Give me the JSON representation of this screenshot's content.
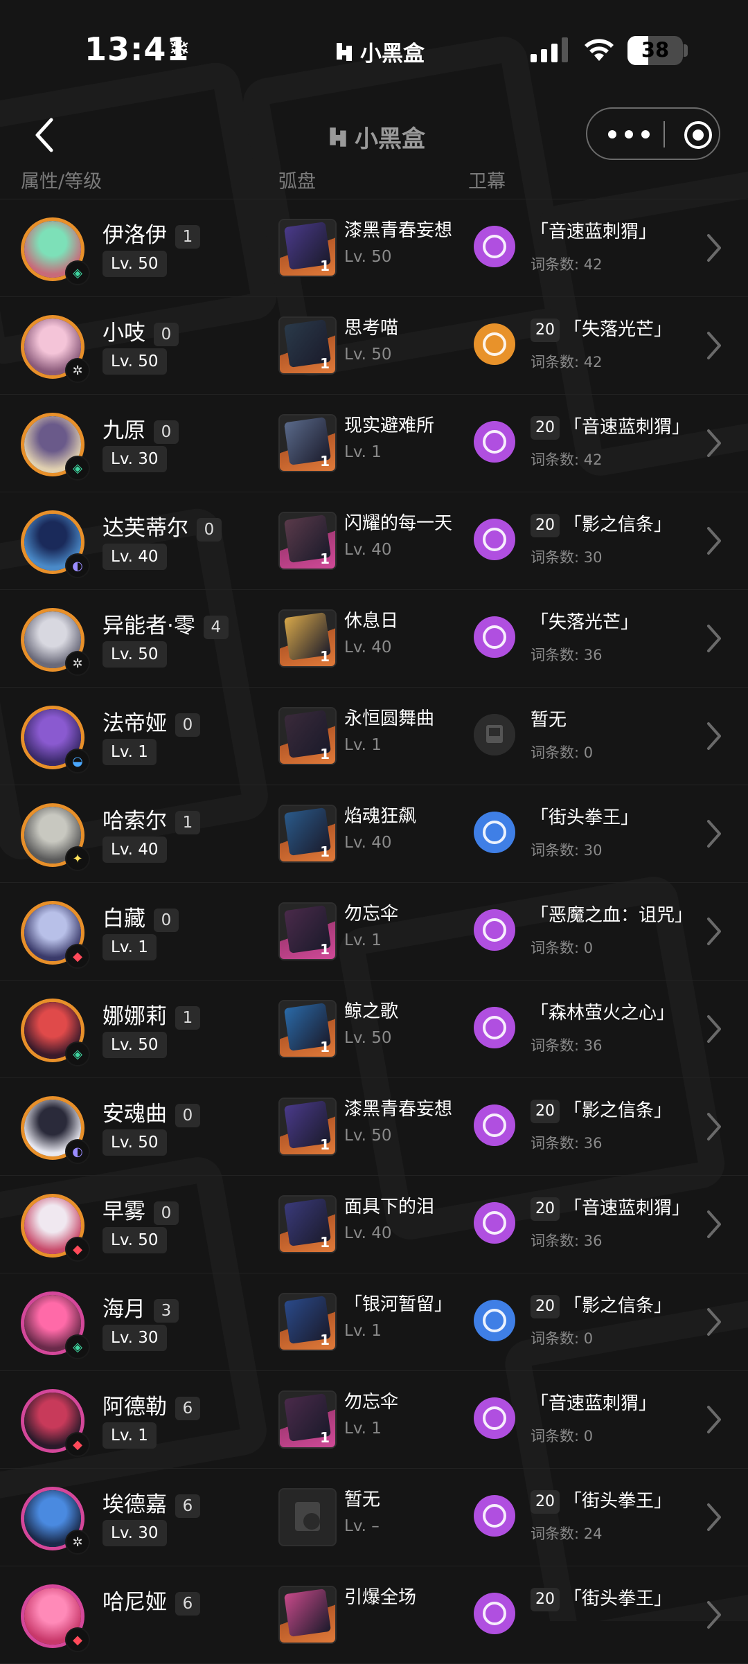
{
  "status_bar": {
    "time": "13:41",
    "snow": "❄",
    "brand": "小黑盒",
    "battery": "38",
    "battery_level": 0.38
  },
  "nav": {
    "title": "小黑盒"
  },
  "columns": {
    "char": "属性/等级",
    "disc": "弧盘",
    "cart": "卫幕"
  },
  "colors": {
    "orange_ring": "#e8902a",
    "pink_ring": "#d4479a",
    "purple": "#b04fe0",
    "blue": "#3f7fe6",
    "gold": "#e8922a"
  },
  "rows": [
    {
      "name": "伊洛伊",
      "mind": "1",
      "level": "Lv. 50",
      "element": "wind",
      "ring": "orange",
      "disc_name": "漆黑青春妄想",
      "disc_level": "Lv. 50",
      "disc_rank": "1",
      "disc_color": "orange",
      "cart_num": "",
      "cart_title": "「音速蓝刺猬」",
      "cart_count": "词条数: 42",
      "cart_color": "purple"
    },
    {
      "name": "小吱",
      "mind": "0",
      "level": "Lv. 50",
      "element": "physical",
      "ring": "orange",
      "disc_name": "思考喵",
      "disc_level": "Lv. 50",
      "disc_rank": "1",
      "disc_color": "orange",
      "cart_num": "20",
      "cart_title": "「失落光芒」",
      "cart_count": "词条数: 42",
      "cart_color": "gold"
    },
    {
      "name": "九原",
      "mind": "0",
      "level": "Lv. 30",
      "element": "wind",
      "ring": "orange",
      "disc_name": "现实避难所",
      "disc_level": "Lv. 1",
      "disc_rank": "1",
      "disc_color": "orange",
      "cart_num": "20",
      "cart_title": "「音速蓝刺猬」",
      "cart_count": "词条数: 42",
      "cart_color": "purple"
    },
    {
      "name": "达芙蒂尔",
      "mind": "0",
      "level": "Lv. 40",
      "element": "dark",
      "ring": "orange",
      "disc_name": "闪耀的每一天",
      "disc_level": "Lv. 40",
      "disc_rank": "1",
      "disc_color": "pink",
      "cart_num": "20",
      "cart_title": "「影之信条」",
      "cart_count": "词条数: 30",
      "cart_color": "purple"
    },
    {
      "name": "异能者·零",
      "mind": "4",
      "level": "Lv. 50",
      "element": "physical",
      "ring": "orange",
      "disc_name": "休息日",
      "disc_level": "Lv. 40",
      "disc_rank": "1",
      "disc_color": "orange",
      "cart_num": "",
      "cart_title": "「失落光芒」",
      "cart_count": "词条数: 36",
      "cart_color": "purple"
    },
    {
      "name": "法帝娅",
      "mind": "0",
      "level": "Lv. 1",
      "element": "water",
      "ring": "orange",
      "disc_name": "永恒圆舞曲",
      "disc_level": "Lv. 1",
      "disc_rank": "1",
      "disc_color": "orange",
      "cart_num": "",
      "cart_title": "暂无",
      "cart_count": "词条数: 0",
      "cart_color": "empty"
    },
    {
      "name": "哈索尔",
      "mind": "1",
      "level": "Lv. 40",
      "element": "light",
      "ring": "orange",
      "disc_name": "焰魂狂飙",
      "disc_level": "Lv. 40",
      "disc_rank": "1",
      "disc_color": "orange",
      "cart_num": "",
      "cart_title": "「街头拳王」",
      "cart_count": "词条数: 30",
      "cart_color": "blue"
    },
    {
      "name": "白藏",
      "mind": "0",
      "level": "Lv. 1",
      "element": "fire",
      "ring": "orange",
      "disc_name": "勿忘伞",
      "disc_level": "Lv. 1",
      "disc_rank": "1",
      "disc_color": "pink",
      "cart_num": "",
      "cart_title": "「恶魔之血：诅咒」",
      "cart_count": "词条数: 0",
      "cart_color": "purple"
    },
    {
      "name": "娜娜莉",
      "mind": "1",
      "level": "Lv. 50",
      "element": "wind",
      "ring": "orange",
      "disc_name": "鲸之歌",
      "disc_level": "Lv. 50",
      "disc_rank": "1",
      "disc_color": "orange",
      "cart_num": "",
      "cart_title": "「森林萤火之心」",
      "cart_count": "词条数: 36",
      "cart_color": "purple"
    },
    {
      "name": "安魂曲",
      "mind": "0",
      "level": "Lv. 50",
      "element": "dark",
      "ring": "orange",
      "disc_name": "漆黑青春妄想",
      "disc_level": "Lv. 50",
      "disc_rank": "1",
      "disc_color": "orange",
      "cart_num": "20",
      "cart_title": "「影之信条」",
      "cart_count": "词条数: 36",
      "cart_color": "purple"
    },
    {
      "name": "早雾",
      "mind": "0",
      "level": "Lv. 50",
      "element": "fire",
      "ring": "orange",
      "disc_name": "面具下的泪",
      "disc_level": "Lv. 40",
      "disc_rank": "1",
      "disc_color": "orange",
      "cart_num": "20",
      "cart_title": "「音速蓝刺猬」",
      "cart_count": "词条数: 36",
      "cart_color": "purple"
    },
    {
      "name": "海月",
      "mind": "3",
      "level": "Lv. 30",
      "element": "wind",
      "ring": "pink",
      "disc_name": "「银河暂留」",
      "disc_level": "Lv. 1",
      "disc_rank": "1",
      "disc_color": "orange",
      "cart_num": "20",
      "cart_title": "「影之信条」",
      "cart_count": "词条数: 0",
      "cart_color": "blue"
    },
    {
      "name": "阿德勒",
      "mind": "6",
      "level": "Lv. 1",
      "element": "fire",
      "ring": "pink",
      "disc_name": "勿忘伞",
      "disc_level": "Lv. 1",
      "disc_rank": "1",
      "disc_color": "pink",
      "cart_num": "",
      "cart_title": "「音速蓝刺猬」",
      "cart_count": "词条数: 0",
      "cart_color": "purple"
    },
    {
      "name": "埃德嘉",
      "mind": "6",
      "level": "Lv. 30",
      "element": "physical",
      "ring": "pink",
      "disc_name": "暂无",
      "disc_level": "Lv. –",
      "disc_rank": "",
      "disc_color": "empty",
      "cart_num": "20",
      "cart_title": "「街头拳王」",
      "cart_count": "词条数: 24",
      "cart_color": "purple"
    },
    {
      "name": "哈尼娅",
      "mind": "6",
      "level": "",
      "element": "fire",
      "ring": "pink",
      "disc_name": "引爆全场",
      "disc_level": "",
      "disc_rank": "",
      "disc_color": "orange",
      "cart_num": "20",
      "cart_title": "「街头拳王」",
      "cart_count": "",
      "cart_color": "purple"
    }
  ]
}
